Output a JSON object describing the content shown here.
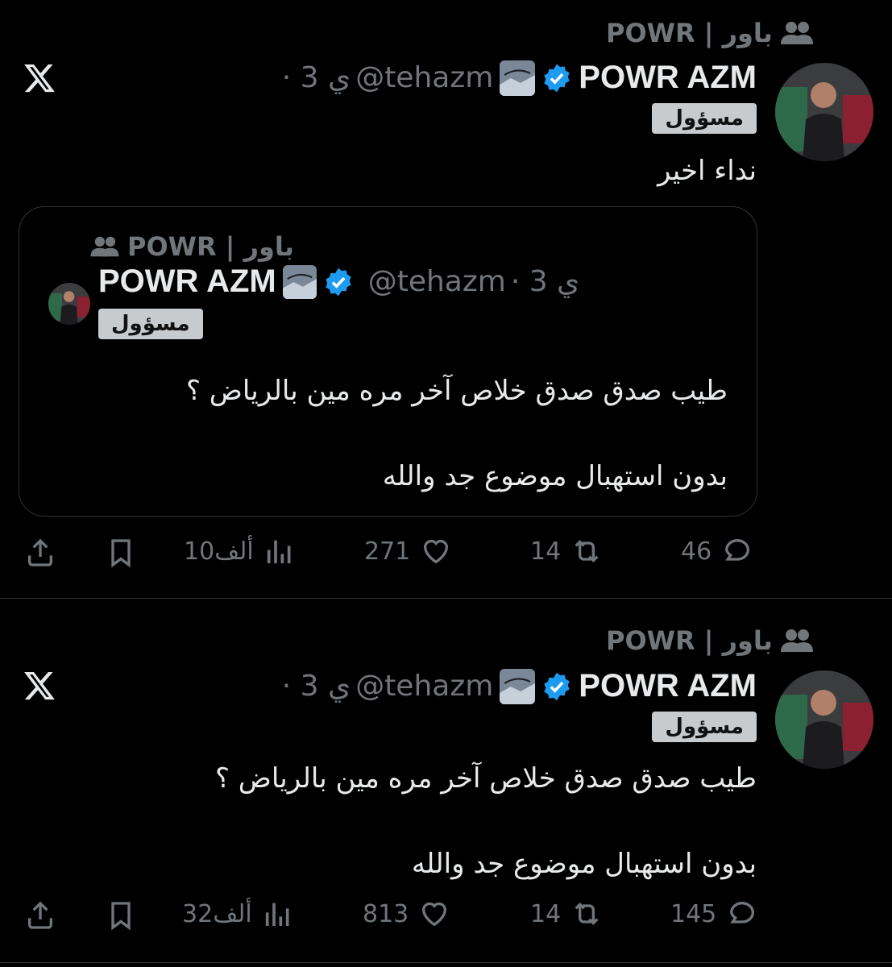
{
  "posts": [
    {
      "community_label": "POWR | باور",
      "display_name": "POWR AZM",
      "handle": "@tehazm",
      "time": "· 3 ي",
      "role": "مسؤول",
      "text": "نداء اخير",
      "quote": {
        "community_label": "POWR | باور",
        "display_name": "POWR AZM",
        "handle": "@tehazm",
        "time": "· 3 ي",
        "role": "مسؤول",
        "line1": "طيب صدق صدق خلاص آخر مره مين بالرياض ؟",
        "line2": "بدون استهبال موضوع جد والله"
      },
      "replies": "46",
      "reposts": "14",
      "likes": "271",
      "views": "10ألف"
    },
    {
      "community_label": "POWR | باور",
      "display_name": "POWR AZM",
      "handle": "@tehazm",
      "time": "· 3 ي",
      "role": "مسؤول",
      "line1": "طيب صدق صدق خلاص آخر مره مين بالرياض ؟",
      "line2": "بدون استهبال موضوع جد والله",
      "replies": "145",
      "reposts": "14",
      "likes": "813",
      "views": "32ألف"
    }
  ],
  "colors": {
    "background": "#000000",
    "muted": "#71767b",
    "text": "#e7e9ea",
    "verified": "#1d9bf0",
    "role_badge": "#c8cbce"
  },
  "icons": [
    "people-icon",
    "verified-icon",
    "x-logo-icon",
    "reply-icon",
    "repost-icon",
    "like-icon",
    "views-icon",
    "bookmark-icon",
    "share-icon"
  ]
}
